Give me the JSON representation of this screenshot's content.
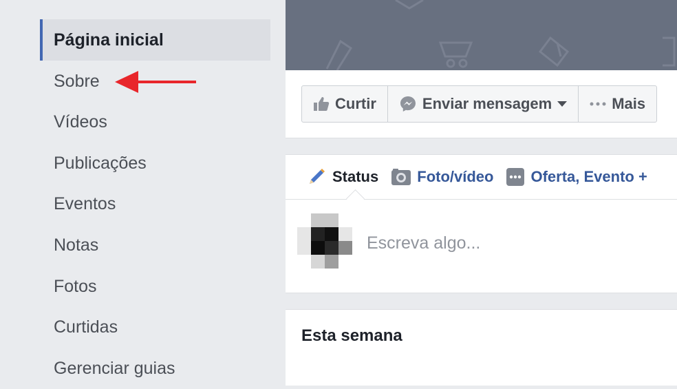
{
  "sidebar": {
    "items": [
      {
        "label": "Página inicial",
        "active": true
      },
      {
        "label": "Sobre"
      },
      {
        "label": "Vídeos"
      },
      {
        "label": "Publicações"
      },
      {
        "label": "Eventos"
      },
      {
        "label": "Notas"
      },
      {
        "label": "Fotos"
      },
      {
        "label": "Curtidas"
      },
      {
        "label": "Gerenciar guias"
      }
    ]
  },
  "colors": {
    "background": "#e9ebee",
    "accent": "#4267b2",
    "link": "#365899",
    "annotation_arrow": "#e8262b",
    "cover": "#687080"
  },
  "actions": {
    "like_label": "Curtir",
    "like_icon": "thumbs-up-icon",
    "message_label": "Enviar mensagem",
    "message_icon": "messenger-icon",
    "more_label": "Mais",
    "more_icon": "ellipsis-icon"
  },
  "composer": {
    "tabs": [
      {
        "label": "Status",
        "icon": "pencil-icon"
      },
      {
        "label": "Foto/vídeo",
        "icon": "camera-icon"
      },
      {
        "label": "Oferta, Evento +",
        "icon": "ellipsis-box-icon"
      }
    ],
    "placeholder": "Escreva algo..."
  },
  "feed": {
    "section_title": "Esta semana"
  }
}
